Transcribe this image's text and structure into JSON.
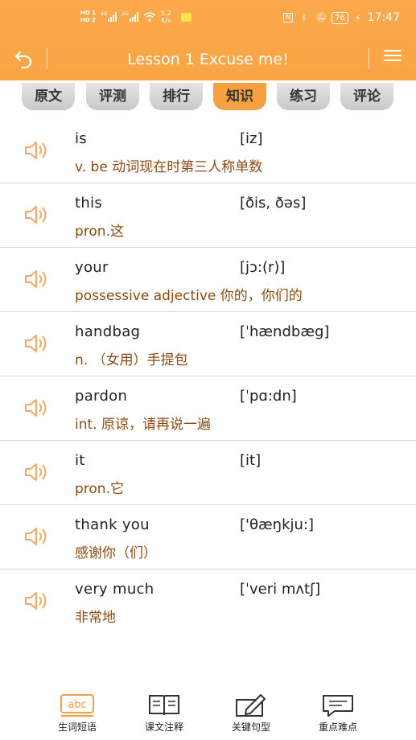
{
  "status_bar": {
    "hd1": "HD 1",
    "hd2": "HD 2",
    "net1": "4G",
    "net2": "5G",
    "speed_value": "5.2",
    "speed_unit": "K/s",
    "battery": "76",
    "time": "17:47"
  },
  "header": {
    "title": "Lesson 1 Excuse me!"
  },
  "tabs": [
    {
      "label": "原文",
      "active": false
    },
    {
      "label": "评测",
      "active": false
    },
    {
      "label": "排行",
      "active": false
    },
    {
      "label": "知识",
      "active": true
    },
    {
      "label": "练习",
      "active": false
    },
    {
      "label": "评论",
      "active": false
    }
  ],
  "words": [
    {
      "word": "is",
      "phonetic": "[iz]",
      "meaning": "v. be 动词现在时第三人称单数"
    },
    {
      "word": "this",
      "phonetic": "[ðis, ðəs]",
      "meaning": "pron.这"
    },
    {
      "word": "your",
      "phonetic": "[jɔ:(r)]",
      "meaning": "possessive adjective 你的，你们的"
    },
    {
      "word": "handbag",
      "phonetic": "[ˈhændbæg]",
      "meaning": "n. （女用）手提包"
    },
    {
      "word": "pardon",
      "phonetic": "[ˈpɑ:dn]",
      "meaning": "int. 原谅，请再说一遍"
    },
    {
      "word": "it",
      "phonetic": "[it]",
      "meaning": "pron.它"
    },
    {
      "word": "thank you",
      "phonetic": "['θæŋkju:]",
      "meaning": "感谢你（们）"
    },
    {
      "word": "very much",
      "phonetic": "[ˈveri mʌtʃ]",
      "meaning": "非常地"
    }
  ],
  "bottom_nav": [
    {
      "label": "生词短语",
      "icon": "abc-icon",
      "icon_text": "abc",
      "active": true
    },
    {
      "label": "课文注释",
      "icon": "book-icon",
      "active": false
    },
    {
      "label": "关键句型",
      "icon": "edit-icon",
      "active": false
    },
    {
      "label": "重点难点",
      "icon": "message-icon",
      "active": false
    }
  ],
  "colors": {
    "accent": "#f8a544",
    "meaning_text": "#8a4b14",
    "speaker": "#f2a868"
  }
}
